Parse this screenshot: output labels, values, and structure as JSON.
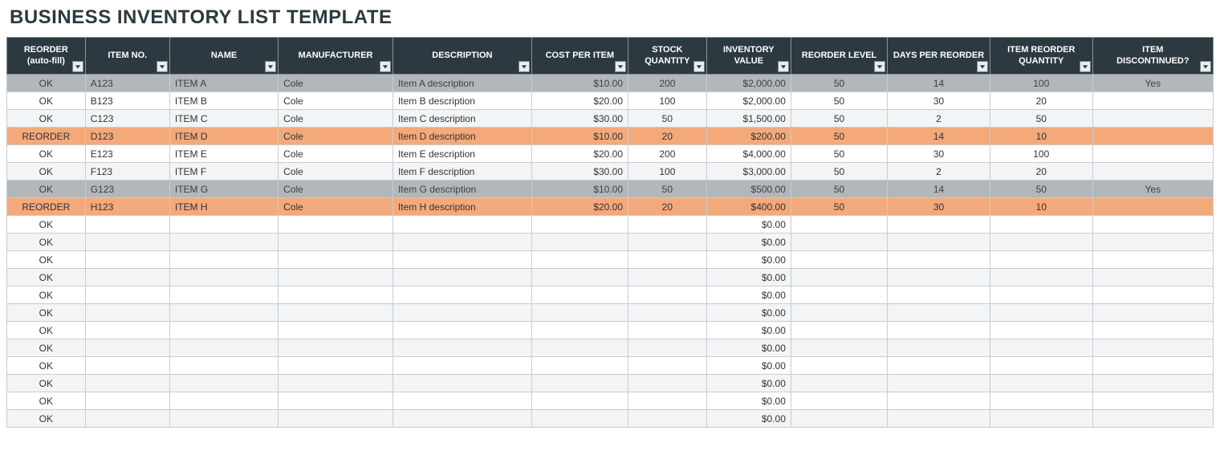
{
  "title": "BUSINESS INVENTORY LIST TEMPLATE",
  "columns": [
    {
      "line1": "REORDER",
      "line2": "(auto-fill)",
      "align": "c"
    },
    {
      "line1": "ITEM NO.",
      "line2": "",
      "align": "l"
    },
    {
      "line1": "NAME",
      "line2": "",
      "align": "l"
    },
    {
      "line1": "MANUFACTURER",
      "line2": "",
      "align": "l"
    },
    {
      "line1": "DESCRIPTION",
      "line2": "",
      "align": "l"
    },
    {
      "line1": "COST PER ITEM",
      "line2": "",
      "align": "r"
    },
    {
      "line1": "STOCK",
      "line2": "QUANTITY",
      "align": "c"
    },
    {
      "line1": "INVENTORY",
      "line2": "VALUE",
      "align": "r"
    },
    {
      "line1": "REORDER LEVEL",
      "line2": "",
      "align": "c"
    },
    {
      "line1": "DAYS PER REORDER",
      "line2": "",
      "align": "c"
    },
    {
      "line1": "ITEM REORDER",
      "line2": "QUANTITY",
      "align": "c"
    },
    {
      "line1": "ITEM",
      "line2": "DISCONTINUED?",
      "align": "c"
    }
  ],
  "rows": [
    {
      "state": "discontinued",
      "reorder": "OK",
      "item_no": "A123",
      "name": "ITEM A",
      "manufacturer": "Cole",
      "description": "Item A description",
      "cost": "$10.00",
      "stock": "200",
      "value": "$2,000.00",
      "level": "50",
      "days": "14",
      "qty": "100",
      "disc": "Yes"
    },
    {
      "state": "plain",
      "reorder": "OK",
      "item_no": "B123",
      "name": "ITEM B",
      "manufacturer": "Cole",
      "description": "Item B description",
      "cost": "$20.00",
      "stock": "100",
      "value": "$2,000.00",
      "level": "50",
      "days": "30",
      "qty": "20",
      "disc": ""
    },
    {
      "state": "alt",
      "reorder": "OK",
      "item_no": "C123",
      "name": "ITEM C",
      "manufacturer": "Cole",
      "description": "Item C description",
      "cost": "$30.00",
      "stock": "50",
      "value": "$1,500.00",
      "level": "50",
      "days": "2",
      "qty": "50",
      "disc": ""
    },
    {
      "state": "reorder",
      "reorder": "REORDER",
      "item_no": "D123",
      "name": "ITEM D",
      "manufacturer": "Cole",
      "description": "Item D description",
      "cost": "$10.00",
      "stock": "20",
      "value": "$200.00",
      "level": "50",
      "days": "14",
      "qty": "10",
      "disc": ""
    },
    {
      "state": "plain",
      "reorder": "OK",
      "item_no": "E123",
      "name": "ITEM E",
      "manufacturer": "Cole",
      "description": "Item E description",
      "cost": "$20.00",
      "stock": "200",
      "value": "$4,000.00",
      "level": "50",
      "days": "30",
      "qty": "100",
      "disc": ""
    },
    {
      "state": "alt",
      "reorder": "OK",
      "item_no": "F123",
      "name": "ITEM F",
      "manufacturer": "Cole",
      "description": "Item F description",
      "cost": "$30.00",
      "stock": "100",
      "value": "$3,000.00",
      "level": "50",
      "days": "2",
      "qty": "20",
      "disc": ""
    },
    {
      "state": "discontinued",
      "reorder": "OK",
      "item_no": "G123",
      "name": "ITEM G",
      "manufacturer": "Cole",
      "description": "Item G description",
      "cost": "$10.00",
      "stock": "50",
      "value": "$500.00",
      "level": "50",
      "days": "14",
      "qty": "50",
      "disc": "Yes"
    },
    {
      "state": "reorder",
      "reorder": "REORDER",
      "item_no": "H123",
      "name": "ITEM H",
      "manufacturer": "Cole",
      "description": "Item H description",
      "cost": "$20.00",
      "stock": "20",
      "value": "$400.00",
      "level": "50",
      "days": "30",
      "qty": "10",
      "disc": ""
    },
    {
      "state": "plain",
      "reorder": "OK",
      "item_no": "",
      "name": "",
      "manufacturer": "",
      "description": "",
      "cost": "",
      "stock": "",
      "value": "$0.00",
      "level": "",
      "days": "",
      "qty": "",
      "disc": ""
    },
    {
      "state": "alt",
      "reorder": "OK",
      "item_no": "",
      "name": "",
      "manufacturer": "",
      "description": "",
      "cost": "",
      "stock": "",
      "value": "$0.00",
      "level": "",
      "days": "",
      "qty": "",
      "disc": ""
    },
    {
      "state": "plain",
      "reorder": "OK",
      "item_no": "",
      "name": "",
      "manufacturer": "",
      "description": "",
      "cost": "",
      "stock": "",
      "value": "$0.00",
      "level": "",
      "days": "",
      "qty": "",
      "disc": ""
    },
    {
      "state": "alt",
      "reorder": "OK",
      "item_no": "",
      "name": "",
      "manufacturer": "",
      "description": "",
      "cost": "",
      "stock": "",
      "value": "$0.00",
      "level": "",
      "days": "",
      "qty": "",
      "disc": ""
    },
    {
      "state": "plain",
      "reorder": "OK",
      "item_no": "",
      "name": "",
      "manufacturer": "",
      "description": "",
      "cost": "",
      "stock": "",
      "value": "$0.00",
      "level": "",
      "days": "",
      "qty": "",
      "disc": ""
    },
    {
      "state": "alt",
      "reorder": "OK",
      "item_no": "",
      "name": "",
      "manufacturer": "",
      "description": "",
      "cost": "",
      "stock": "",
      "value": "$0.00",
      "level": "",
      "days": "",
      "qty": "",
      "disc": ""
    },
    {
      "state": "plain",
      "reorder": "OK",
      "item_no": "",
      "name": "",
      "manufacturer": "",
      "description": "",
      "cost": "",
      "stock": "",
      "value": "$0.00",
      "level": "",
      "days": "",
      "qty": "",
      "disc": ""
    },
    {
      "state": "alt",
      "reorder": "OK",
      "item_no": "",
      "name": "",
      "manufacturer": "",
      "description": "",
      "cost": "",
      "stock": "",
      "value": "$0.00",
      "level": "",
      "days": "",
      "qty": "",
      "disc": ""
    },
    {
      "state": "plain",
      "reorder": "OK",
      "item_no": "",
      "name": "",
      "manufacturer": "",
      "description": "",
      "cost": "",
      "stock": "",
      "value": "$0.00",
      "level": "",
      "days": "",
      "qty": "",
      "disc": ""
    },
    {
      "state": "alt",
      "reorder": "OK",
      "item_no": "",
      "name": "",
      "manufacturer": "",
      "description": "",
      "cost": "",
      "stock": "",
      "value": "$0.00",
      "level": "",
      "days": "",
      "qty": "",
      "disc": ""
    },
    {
      "state": "plain",
      "reorder": "OK",
      "item_no": "",
      "name": "",
      "manufacturer": "",
      "description": "",
      "cost": "",
      "stock": "",
      "value": "$0.00",
      "level": "",
      "days": "",
      "qty": "",
      "disc": ""
    },
    {
      "state": "alt",
      "reorder": "OK",
      "item_no": "",
      "name": "",
      "manufacturer": "",
      "description": "",
      "cost": "",
      "stock": "",
      "value": "$0.00",
      "level": "",
      "days": "",
      "qty": "",
      "disc": ""
    }
  ]
}
